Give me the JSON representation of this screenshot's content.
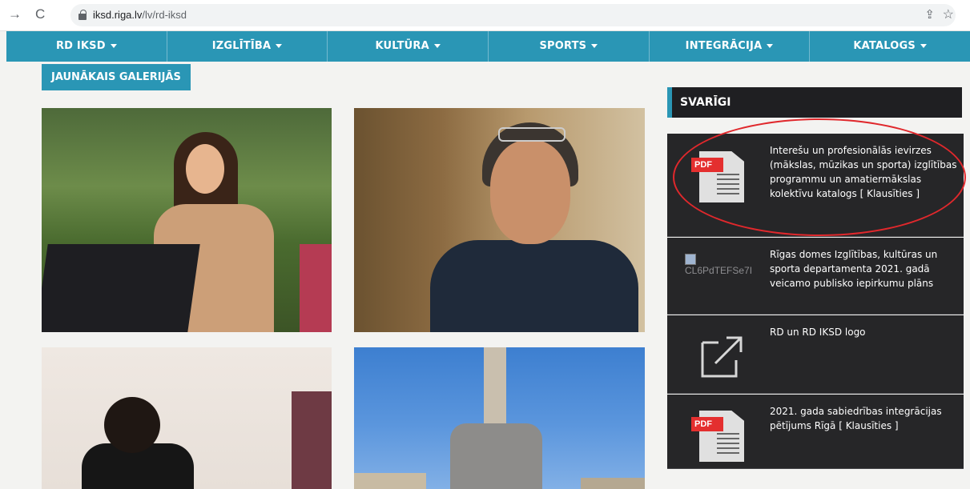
{
  "browser": {
    "url_host": "iksd.riga.lv",
    "url_path": "/lv/rd-iksd"
  },
  "nav": {
    "items": [
      "RD IKSD",
      "IZGLĪTĪBA",
      "KULTŪRA",
      "SPORTS",
      "INTEGRĀCIJA",
      "KATALOGS"
    ]
  },
  "galleries_tab": "JAUNĀKAIS GALERIJĀS",
  "sidebar": {
    "heading": "SVARĪGI",
    "items": [
      {
        "text": "Interešu un profesionālās ievirzes (mākslas, mūzikas un sporta) izglītības programmu un amatiermākslas kolektīvu katalogs [ Klausīties ]",
        "icon": "pdf-icon",
        "icon_label": "PDF"
      },
      {
        "text": "Rīgas domes Izglītības, kultūras un sporta departamenta 2021. gadā veicamo publisko iepirkumu plāns",
        "icon": "broken-image",
        "icon_label": "CL6PdTEFSe7I"
      },
      {
        "text": "RD un RD IKSD logo",
        "icon": "external-link-icon"
      },
      {
        "text": "2021. gada sabiedrības integrācijas pētījums Rīgā [ Klausīties ]",
        "icon": "pdf-icon",
        "icon_label": "PDF"
      }
    ]
  },
  "colors": {
    "accent": "#2a96b5",
    "panel": "#262628",
    "pdf_red": "#e42f2f",
    "annotation_red": "#e0282c"
  }
}
